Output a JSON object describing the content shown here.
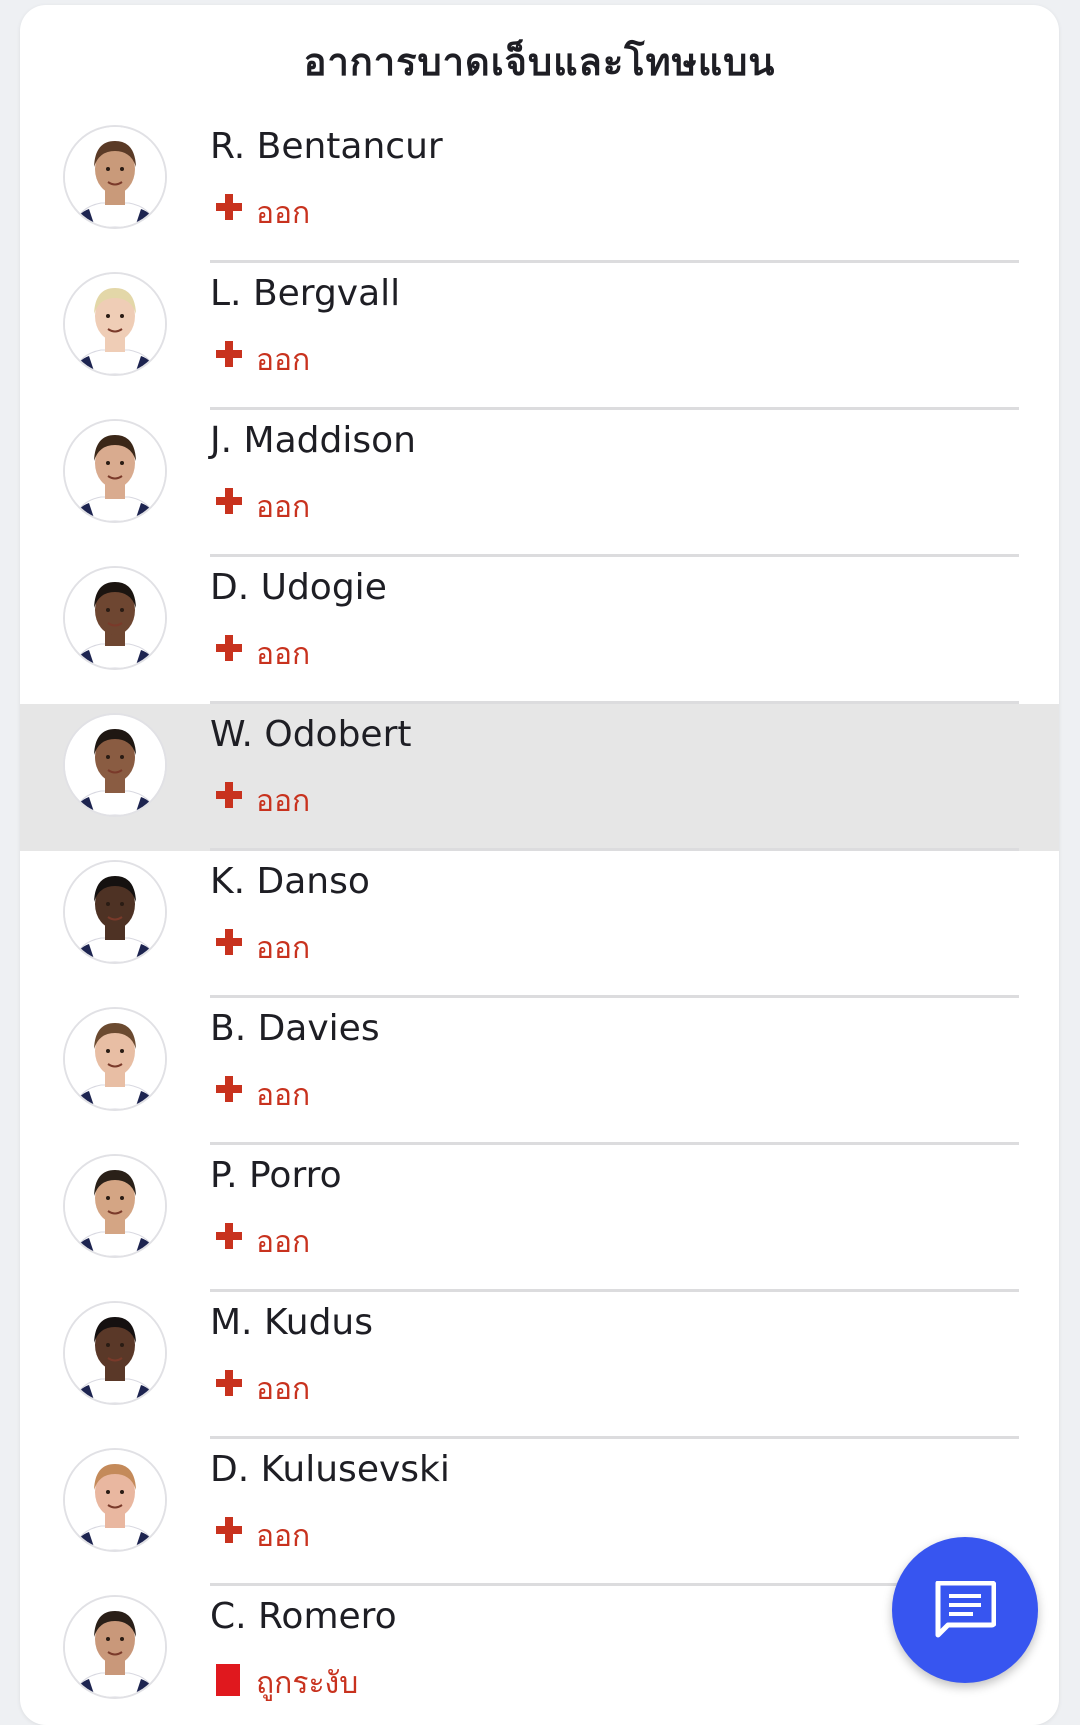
{
  "section": {
    "title": "อาการบาดเจ็บและโทษแบน"
  },
  "players": [
    {
      "name": "R. Bentancur",
      "status": "ออก",
      "status_icon": "injury-cross-icon",
      "hair": "#5a3a26",
      "skin": "#c99a7a"
    },
    {
      "name": "L. Bergvall",
      "status": "ออก",
      "status_icon": "injury-cross-icon",
      "hair": "#e3d7a8",
      "skin": "#efcdb6"
    },
    {
      "name": "J. Maddison",
      "status": "ออก",
      "status_icon": "injury-cross-icon",
      "hair": "#3b2718",
      "skin": "#d9ab8f"
    },
    {
      "name": "D. Udogie",
      "status": "ออก",
      "status_icon": "injury-cross-icon",
      "hair": "#1b1410",
      "skin": "#6e4631"
    },
    {
      "name": "W. Odobert",
      "status": "ออก",
      "status_icon": "injury-cross-icon",
      "hair": "#1f1712",
      "skin": "#8a5c42"
    },
    {
      "name": "K. Danso",
      "status": "ออก",
      "status_icon": "injury-cross-icon",
      "hair": "#151110",
      "skin": "#4e3224"
    },
    {
      "name": "B. Davies",
      "status": "ออก",
      "status_icon": "injury-cross-icon",
      "hair": "#6b4a30",
      "skin": "#e8bea4"
    },
    {
      "name": "P. Porro",
      "status": "ออก",
      "status_icon": "injury-cross-icon",
      "hair": "#2a2018",
      "skin": "#d4a584"
    },
    {
      "name": "M. Kudus",
      "status": "ออก",
      "status_icon": "injury-cross-icon",
      "hair": "#151010",
      "skin": "#5a3828"
    },
    {
      "name": "D. Kulusevski",
      "status": "ออก",
      "status_icon": "injury-cross-icon",
      "hair": "#c48a5a",
      "skin": "#e9b7a0"
    },
    {
      "name": "C. Romero",
      "status": "ถูกระงับ",
      "status_icon": "red-card-icon",
      "hair": "#2a1f18",
      "skin": "#c9987a"
    }
  ],
  "highlighted_player": "W. Odobert",
  "fab": {
    "icon": "chat-icon"
  },
  "colors": {
    "accent": "#3755f0",
    "status_red": "#c8321e",
    "red_card": "#e0181e"
  }
}
